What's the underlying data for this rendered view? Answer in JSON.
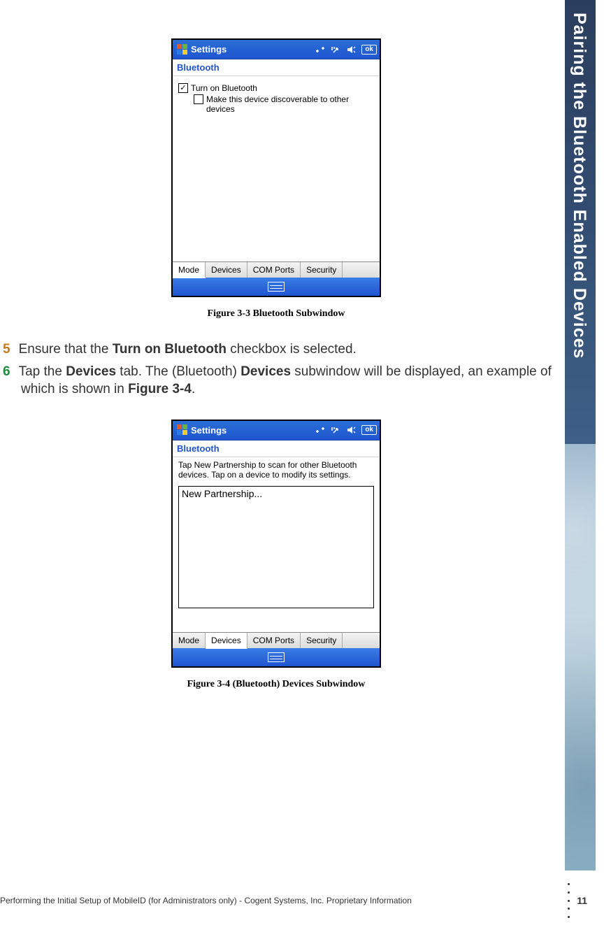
{
  "sidebar": {
    "title": "Pairing the Bluetooth Enabled Devices"
  },
  "figures": {
    "f1": {
      "caption": "Figure 3-3 Bluetooth Subwindow",
      "titlebar": "Settings",
      "ok": "ok",
      "subtitle": "Bluetooth",
      "chk1": "Turn on Bluetooth",
      "chk2": "Make this device discoverable to other devices",
      "tabs": {
        "mode": "Mode",
        "devices": "Devices",
        "com": "COM Ports",
        "security": "Security"
      }
    },
    "f2": {
      "caption": "Figure 3-4 (Bluetooth) Devices Subwindow",
      "titlebar": "Settings",
      "ok": "ok",
      "subtitle": "Bluetooth",
      "help": "Tap New Partnership to scan for other Bluetooth devices. Tap on a device to modify its settings.",
      "list_item": "New Partnership...",
      "tabs": {
        "mode": "Mode",
        "devices": "Devices",
        "com": "COM Ports",
        "security": "Security"
      }
    }
  },
  "steps": {
    "s5": {
      "num": "5",
      "pre": "Ensure that the ",
      "bold": "Turn on Bluetooth",
      "post": " checkbox is selected."
    },
    "s6": {
      "num": "6",
      "pre": "Tap the ",
      "b1": "Devices",
      "mid1": " tab. The (Bluetooth) ",
      "b2": "Devices",
      "mid2": " subwindow will be displayed, an example of which is shown in ",
      "figref": "Figure 3-4",
      "tail": "."
    }
  },
  "footer": {
    "text": "Performing the Initial Setup of MobileID (for Administrators only)  - Cogent Systems, Inc. Proprietary Information",
    "page": "11"
  }
}
